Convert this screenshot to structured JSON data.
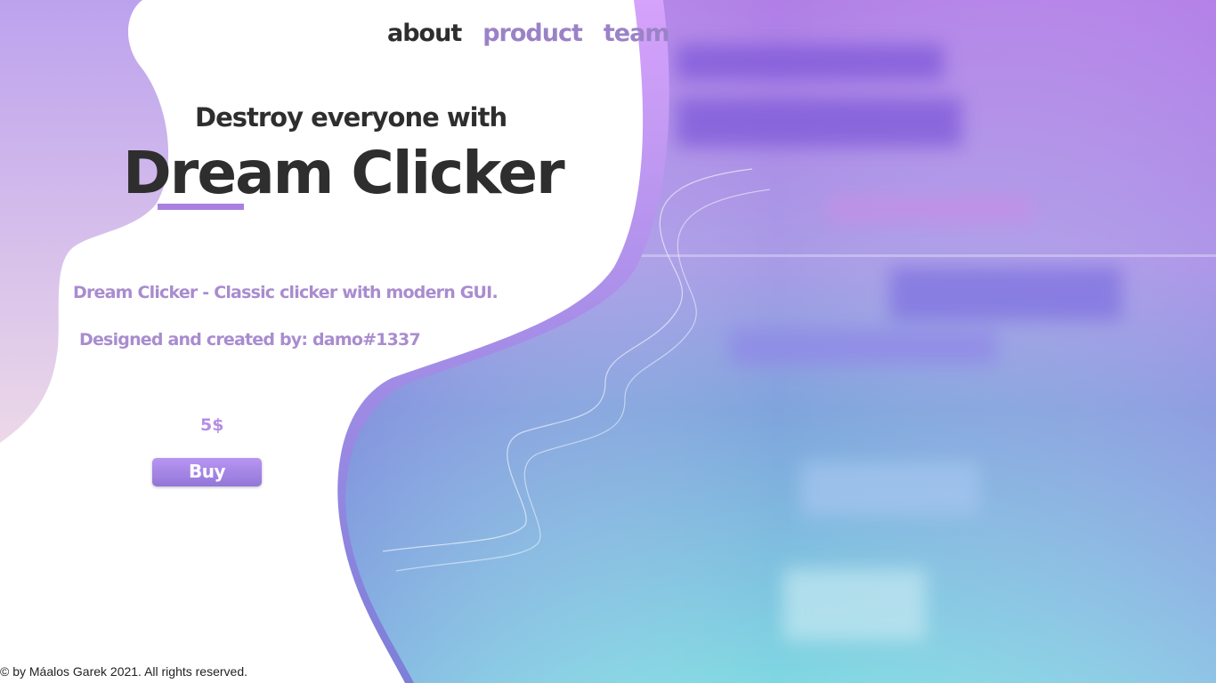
{
  "nav": {
    "items": [
      {
        "label": "about",
        "active": true
      },
      {
        "label": "product",
        "active": false
      },
      {
        "label": "team",
        "active": false
      }
    ]
  },
  "hero": {
    "tagline": "Destroy everyone with",
    "title": "Dream Clicker"
  },
  "content": {
    "description": "Dream Clicker - Classic clicker with modern GUI.",
    "credits": "Designed and created by: damo#1337"
  },
  "product": {
    "price": "5$",
    "buy_label": "Buy"
  },
  "footer": {
    "copyright": "© by Máalos Garek 2021. All rights reserved."
  },
  "colors": {
    "accent": "#a980e0",
    "nav_inactive": "#9b82c7",
    "text_dark": "#2e2e2e",
    "text_muted": "#a98ccf",
    "button_top": "#b895f2",
    "button_bottom": "#9277d8"
  }
}
